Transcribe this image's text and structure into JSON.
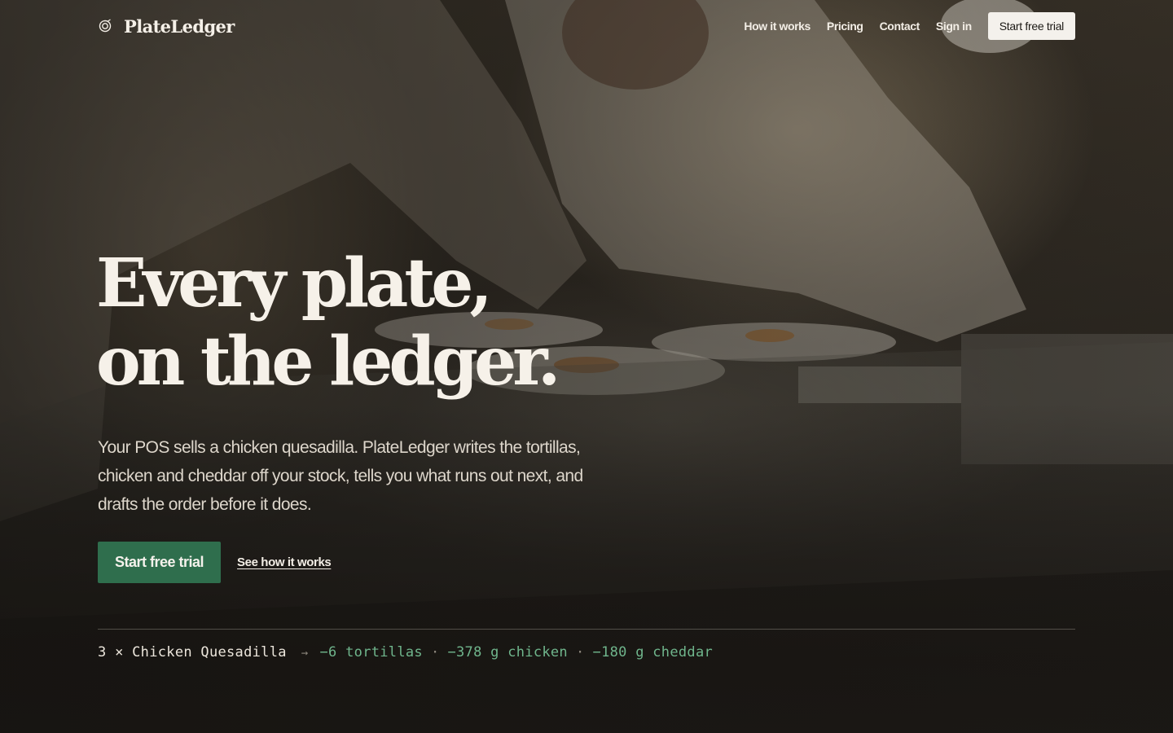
{
  "brand": {
    "name": "PlateLedger",
    "icon": "target-icon"
  },
  "nav": {
    "links": [
      "How it works",
      "Pricing",
      "Contact",
      "Sign in"
    ],
    "cta": "Start free trial"
  },
  "hero": {
    "headline_line1": "Every plate,",
    "headline_line2": "on the ledger.",
    "lede": "Your POS sells a chicken quesadilla. PlateLedger writes the tortillas, chicken and cheddar off your stock, tells you what runs out next, and drafts the order before it does.",
    "primary_cta": "Start free trial",
    "secondary_cta": "See how it works"
  },
  "ticker": {
    "order": "3 × Chicken Quesadilla",
    "arrow": "→",
    "items": [
      "−6 tortillas",
      "−378 g chicken",
      "−180 g cheddar"
    ],
    "separator": "·"
  },
  "colors": {
    "accent_green": "#2f6e4d",
    "ticker_green": "#6fb58c",
    "text_light": "#f3eee6"
  }
}
